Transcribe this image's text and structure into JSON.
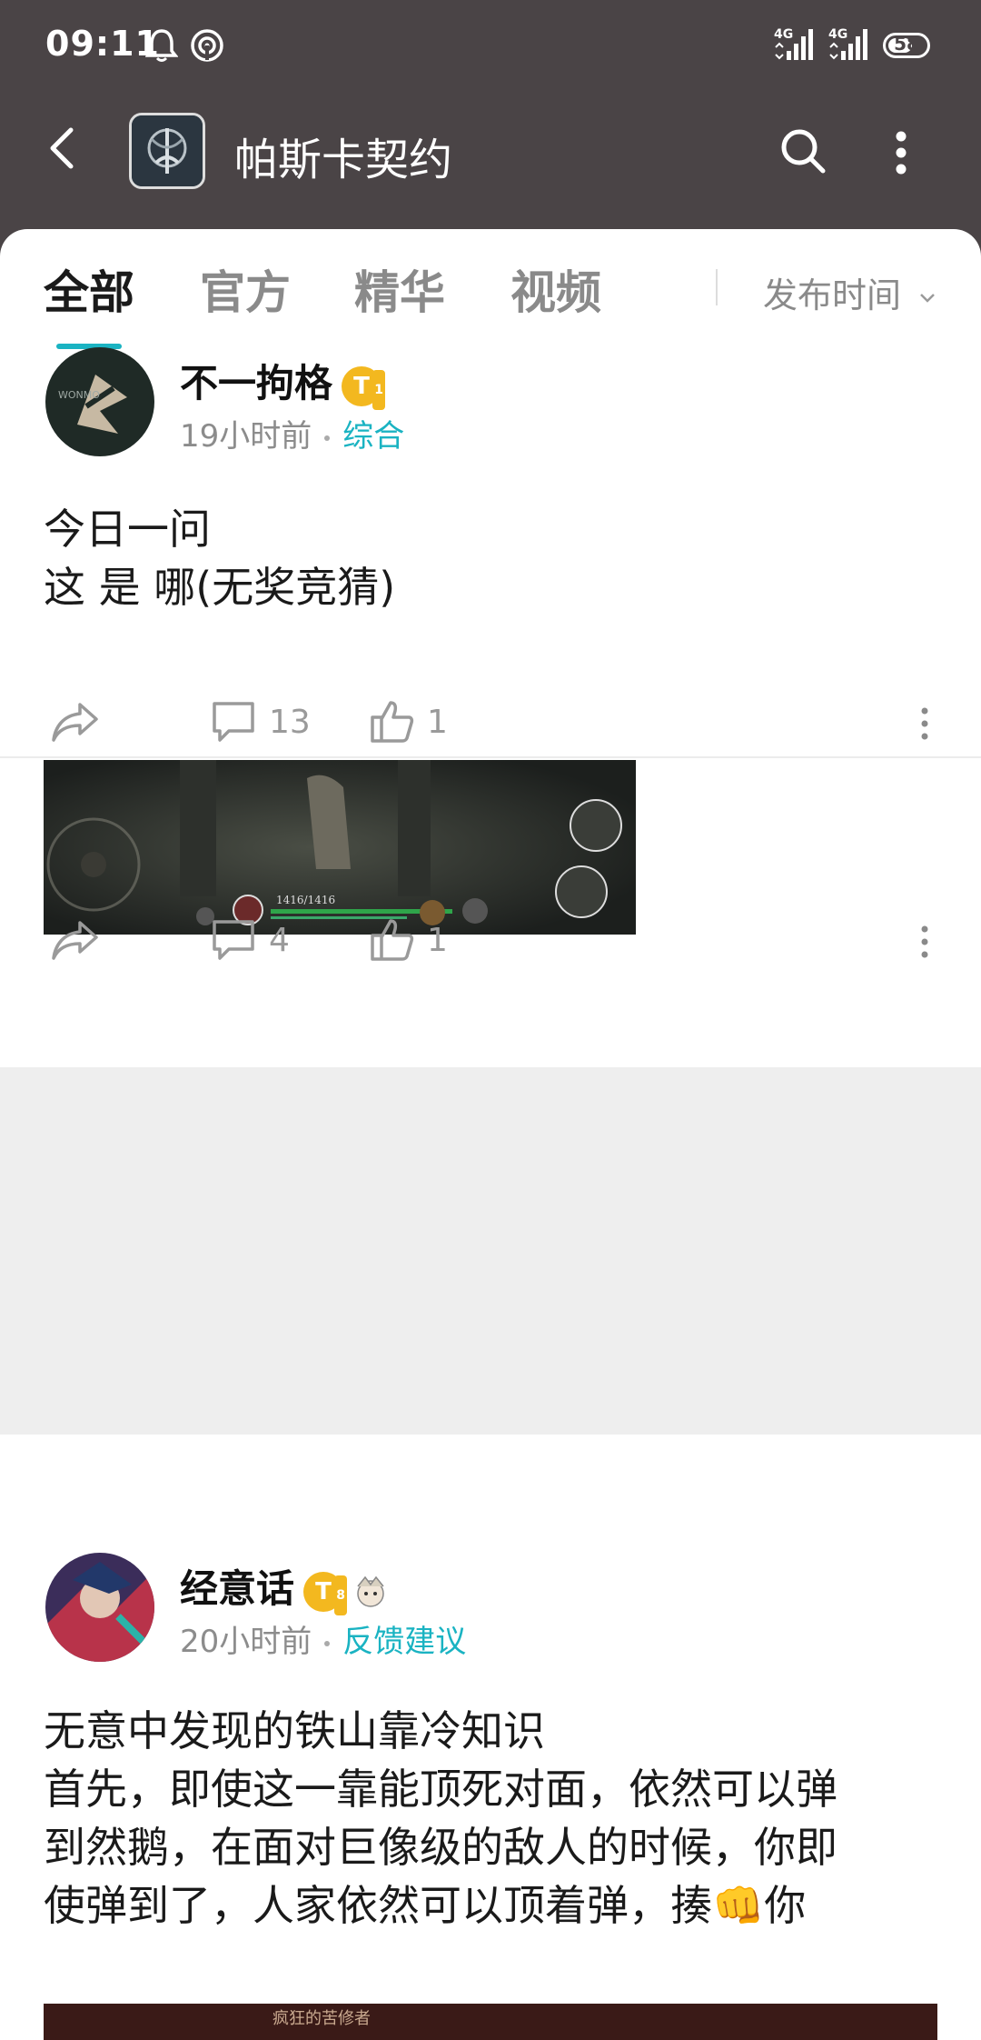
{
  "status_bar": {
    "time": "09:11",
    "signal1": "4G",
    "signal2": "4G",
    "battery": "58"
  },
  "header": {
    "title": "帕斯卡契约"
  },
  "tabs": [
    {
      "label": "全部",
      "active": true
    },
    {
      "label": "官方",
      "active": false
    },
    {
      "label": "精华",
      "active": false
    },
    {
      "label": "视频",
      "active": false
    }
  ],
  "sort": {
    "label": "发布时间"
  },
  "posts": [
    {
      "author": "不一拘格",
      "badge": "T",
      "badge_level": "1",
      "time": "19小时前",
      "category": "综合",
      "lines": [
        "今日一问",
        "这 是 哪(无奖竞猜)"
      ],
      "comments": "13",
      "likes": "1"
    },
    {
      "image_hud": "1416/1416",
      "comments": "4",
      "likes": "1"
    },
    {
      "author": "经意话",
      "badge": "T",
      "badge_level": "8",
      "time": "20小时前",
      "category": "反馈建议",
      "lines": [
        "无意中发现的铁山靠冷知识",
        "首先，即使这一靠能顶死对面，依然可以弹",
        "到然鹅，在面对巨像级的敌人的时候，你即",
        "使弹到了，人家依然可以顶着弹，揍👊你"
      ],
      "image_caption": "疯狂的苦修者"
    }
  ],
  "colors": {
    "header_bg": "#4a4446",
    "accent": "#1ab3c2",
    "badge": "#f3b81f"
  }
}
